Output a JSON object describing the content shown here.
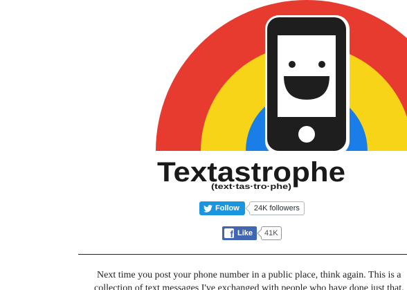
{
  "logo": {
    "title": "Textastrophe",
    "pronunciation": "(text·tas·tro·phe)",
    "colors": {
      "red": "#e63b2e",
      "yellow": "#f7d417",
      "blue": "#1a7ee8",
      "phone": "#1e1e1e",
      "text": "#1a1a1a"
    }
  },
  "twitter": {
    "follow_label": "Follow",
    "followers": "24K followers",
    "icon": "twitter-bird-icon",
    "color": "#1b95e0"
  },
  "facebook": {
    "like_label": "Like",
    "count": "41K",
    "icon": "facebook-f-icon",
    "color": "#4267b2"
  },
  "intro": {
    "text": "Next time you post your phone number in a public place, think again. This is a collection of text messages I've exchanged with people who have done just that."
  }
}
